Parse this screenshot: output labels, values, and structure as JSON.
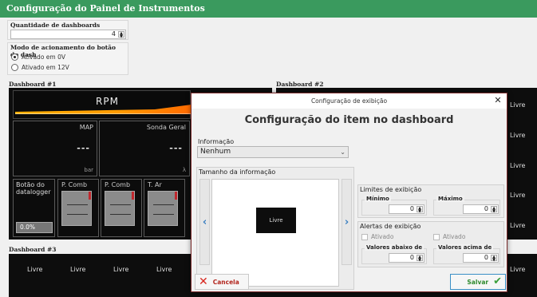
{
  "window": {
    "title": "Configuração do Painel de Instrumentos"
  },
  "settings": {
    "dashboard_count_label": "Quantidade de dashboards",
    "dashboard_count_value": "4",
    "button_mode_label": "Modo de acionamento do botão do dash",
    "button_mode_options": [
      "Ativado em 0V",
      "Ativado em 12V"
    ],
    "button_mode_selected": "Ativado em 0V"
  },
  "dashboards": {
    "d1_label": "Dashboard #1",
    "d2_label": "Dashboard #2",
    "d3_label": "Dashboard #3",
    "rpm_label": "RPM",
    "sensors": [
      {
        "name": "MAP",
        "value": "---",
        "unit": "bar"
      },
      {
        "name": "Sonda Geral",
        "value": "---",
        "unit": "λ"
      }
    ],
    "datalogger": {
      "name": "Botão do datalogger",
      "value": "0.0%"
    },
    "gauges": [
      "P. Comb",
      "P. Comb",
      "T. Ar"
    ],
    "d2_right_cells": [
      "Livre",
      "Livre",
      "Livre",
      "Livre",
      "Livre"
    ],
    "d3_cells": [
      "Livre",
      "Livre",
      "Livre",
      "Livre"
    ],
    "d4_right_cell": "Livre"
  },
  "modal": {
    "title": "Configuração de exibição",
    "heading": "Configuração do item no dashboard",
    "info_label": "Informação",
    "info_value": "Nenhum",
    "size_label": "Tamanho da informação",
    "preview_tile": "Livre",
    "limits_label": "Limites de exibição",
    "min_label": "Mínimo",
    "min_value": "0",
    "max_label": "Máximo",
    "max_value": "0",
    "alerts_label": "Alertas de exibição",
    "alert_low_check": "Ativado",
    "alert_high_check": "Ativado",
    "below_label": "Valores abaixo de",
    "below_value": "0",
    "above_label": "Valores acima de",
    "above_value": "0",
    "cancel_label": "Cancela",
    "save_label": "Salvar"
  },
  "colors": {
    "title_bar": "#3a9a5e",
    "cancel_icon": "#d7261e",
    "save_icon": "#3a9f3a",
    "nav_arrow": "#3a7fc1"
  },
  "icons": {
    "close": "close-icon",
    "cancel": "x-icon",
    "save": "check-icon",
    "prev": "chevron-left-icon",
    "next": "chevron-right-icon"
  }
}
